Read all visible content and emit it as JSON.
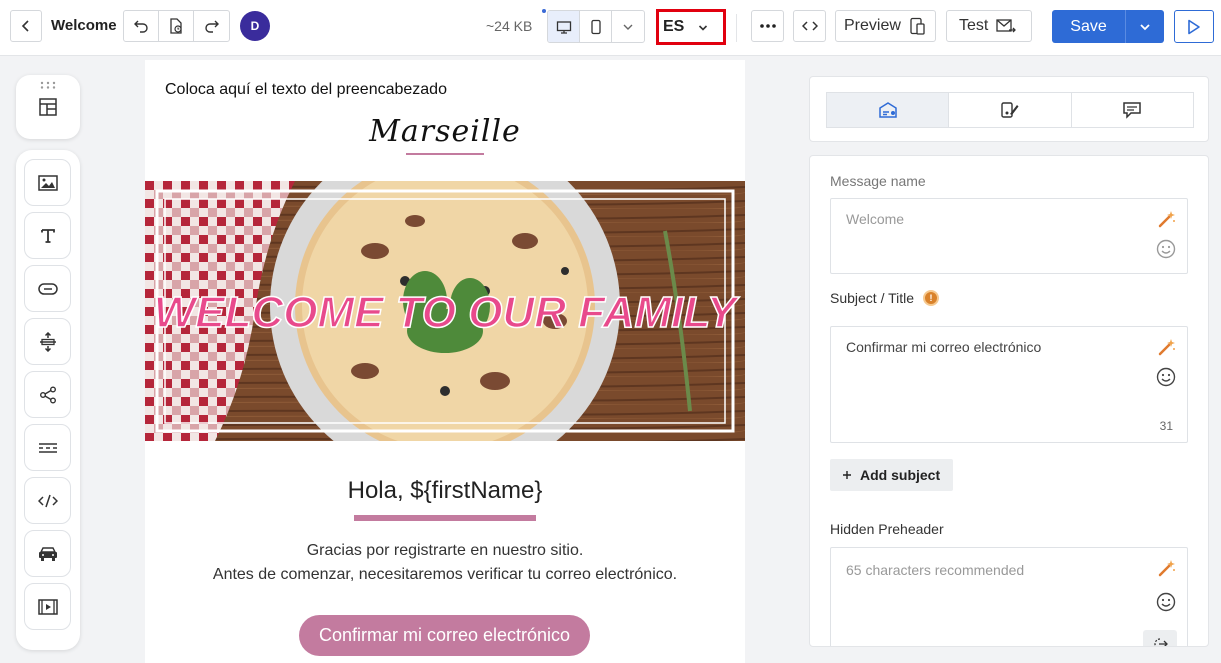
{
  "header": {
    "title": "Welcome",
    "avatar_initial": "D",
    "size": "~24 KB",
    "language": "ES",
    "preview_label": "Preview",
    "test_label": "Test",
    "save_label": "Save",
    "colors": {
      "accent": "#2e6bd6",
      "avatar": "#3a2c9c",
      "highlight": "#e1000f"
    }
  },
  "email": {
    "preheader": "Coloca aquí el texto del preencabezado",
    "logo": "Marseille",
    "hero_text": "WELCOME TO OUR FAMILY",
    "greeting": "Hola, ${firstName}",
    "body_line1": "Gracias por registrarte en nuestro sitio.",
    "body_line2": "Antes de comenzar, necesitaremos verificar tu correo electrónico.",
    "cta": "Confirmar mi correo electrónico",
    "colors": {
      "accent": "#c37b9f"
    }
  },
  "panel": {
    "message_name_label": "Message name",
    "message_name_value": "Welcome",
    "subject_label": "Subject / Title",
    "subject_value": "Confirmar mi correo electrónico",
    "subject_count": "31",
    "add_subject_label": "Add subject",
    "hidden_preheader_label": "Hidden Preheader",
    "hidden_preheader_placeholder": "65 characters recommended"
  },
  "toolbar": {
    "tools": [
      "image-icon",
      "text-icon",
      "button-icon",
      "spacer-icon",
      "social-icon",
      "divider-icon",
      "html-icon",
      "menu-icon",
      "video-icon"
    ]
  }
}
